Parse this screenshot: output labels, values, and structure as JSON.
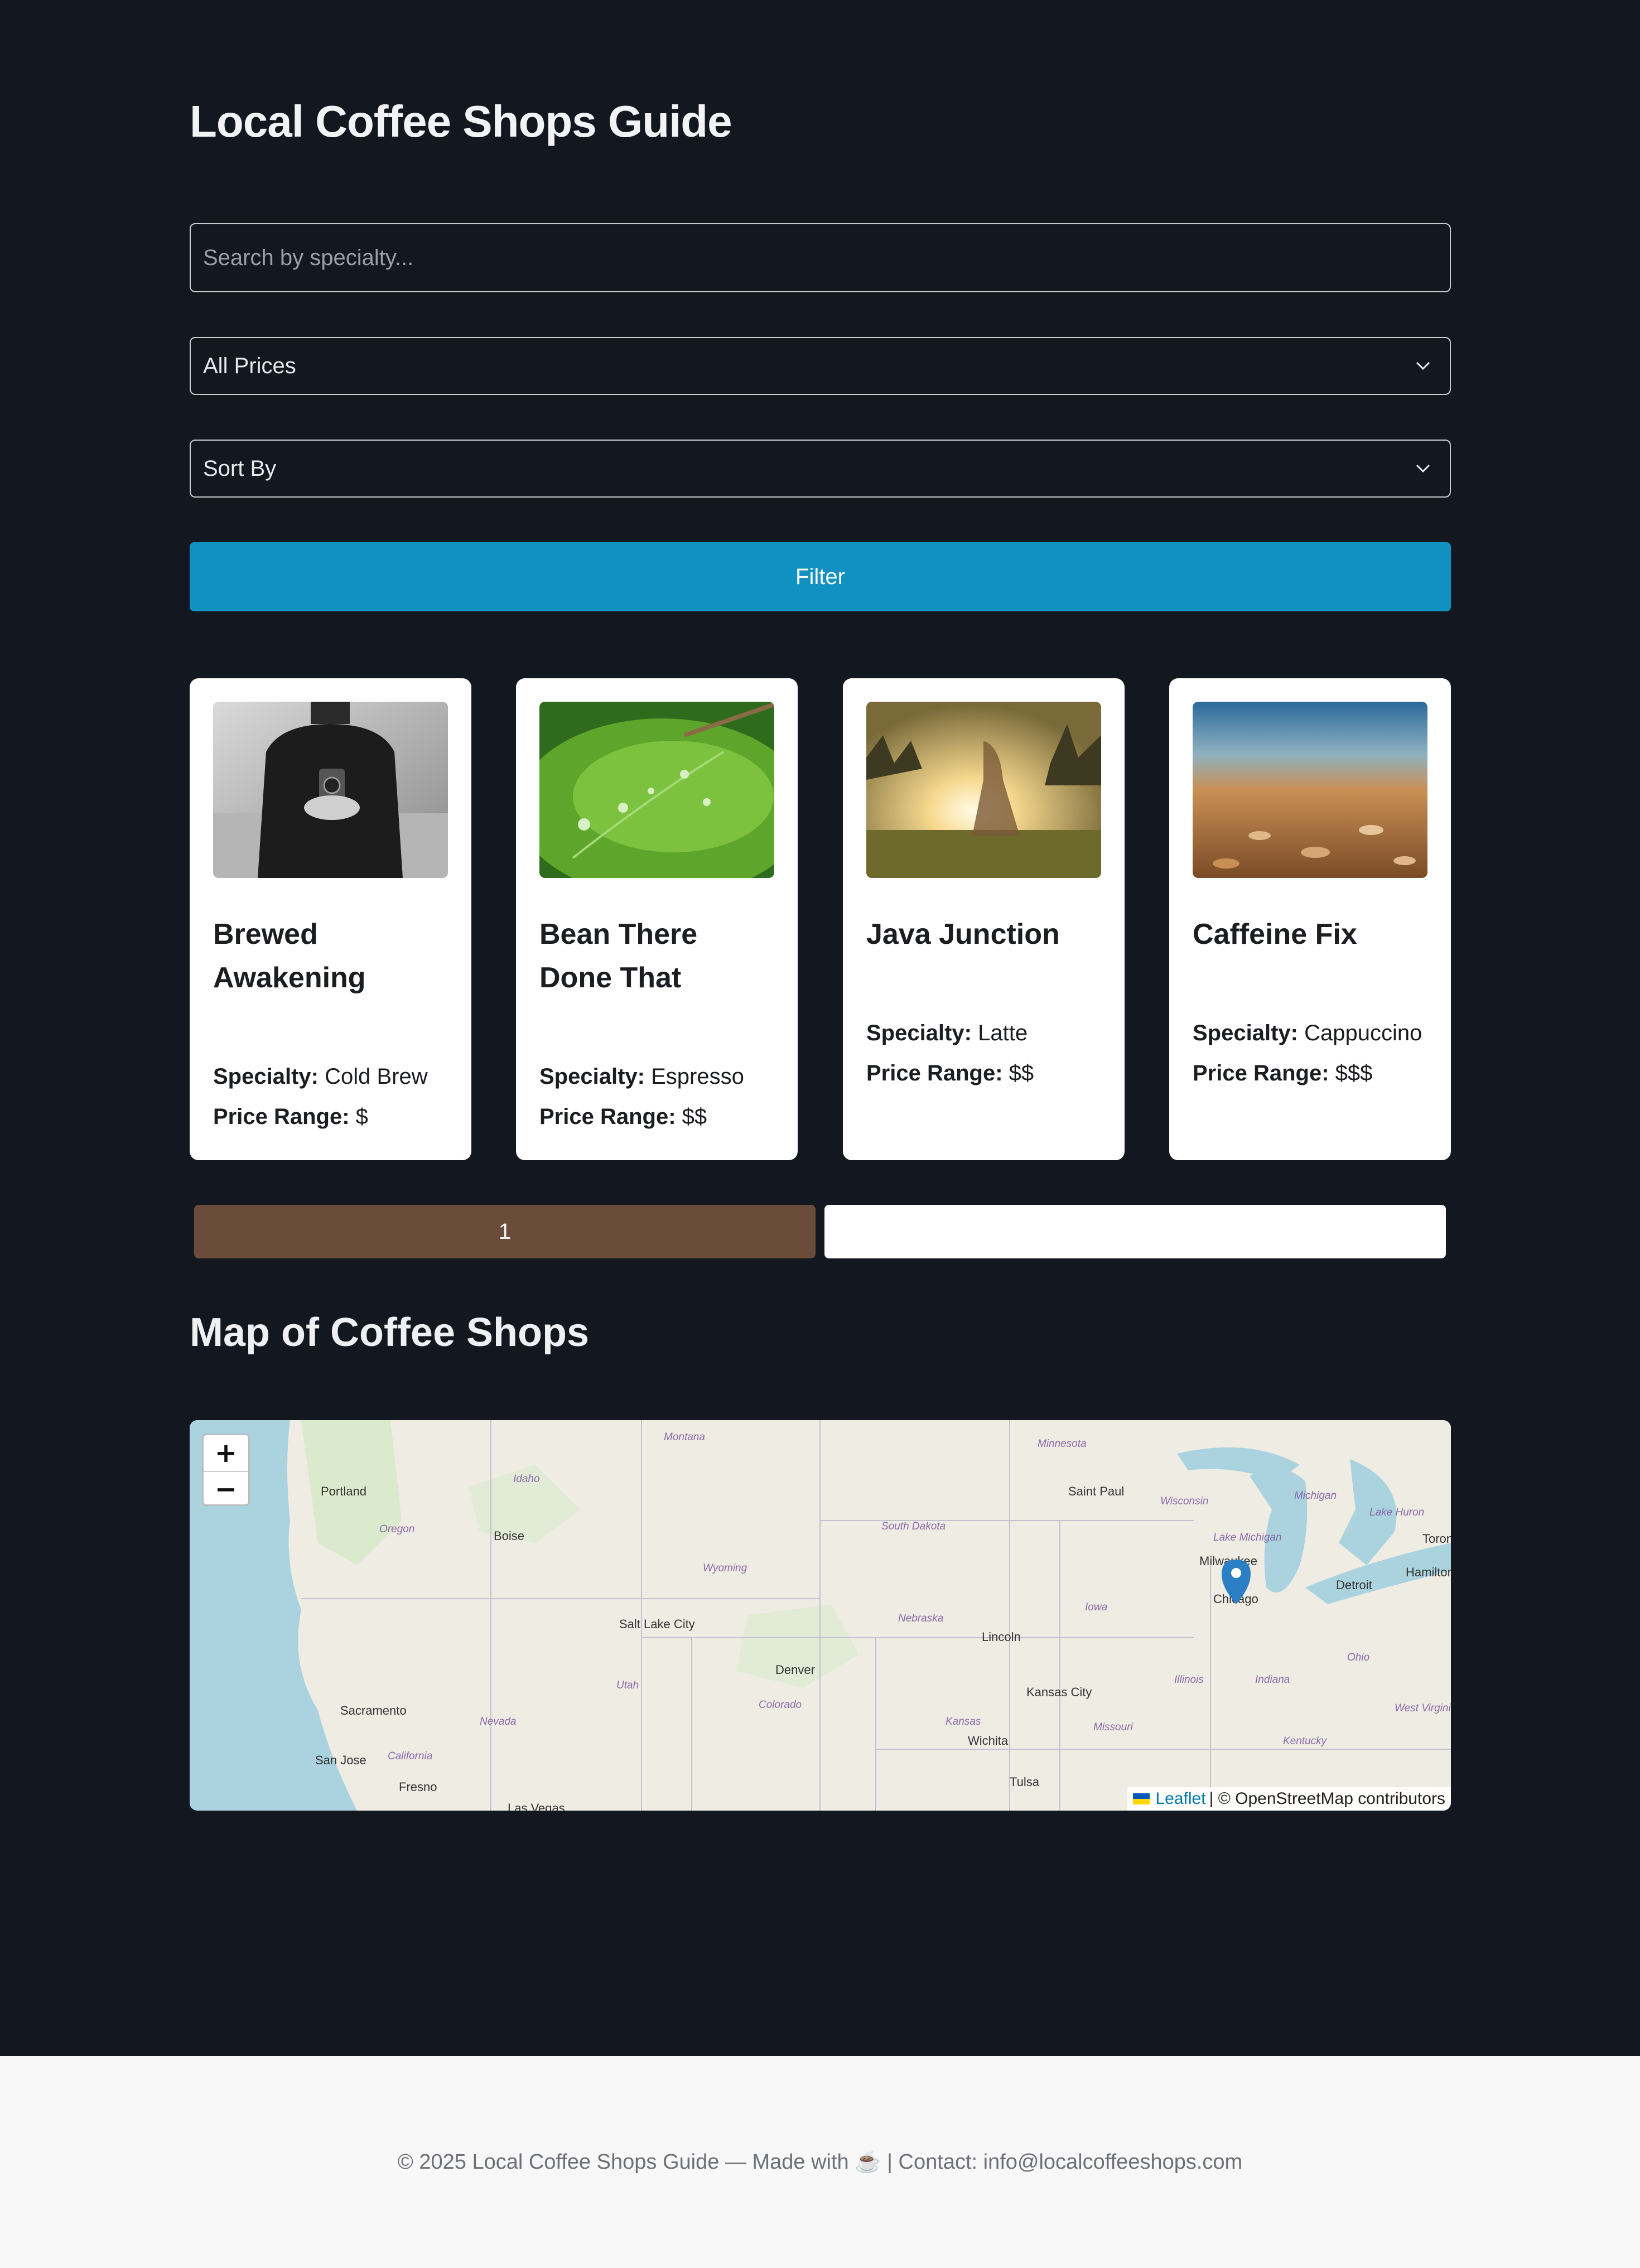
{
  "page": {
    "title": "Local Coffee Shops Guide"
  },
  "filters": {
    "search_placeholder": "Search by specialty...",
    "price_selected": "All Prices",
    "sort_selected": "Sort By",
    "filter_label": "Filter"
  },
  "shops": [
    {
      "name": "Brewed Awakening",
      "specialty_label": "Specialty:",
      "specialty": "Cold Brew",
      "price_label": "Price Range:",
      "price": "$"
    },
    {
      "name": "Bean There Done That",
      "specialty_label": "Specialty:",
      "specialty": "Espresso",
      "price_label": "Price Range:",
      "price": "$$"
    },
    {
      "name": "Java Junction",
      "specialty_label": "Specialty:",
      "specialty": "Latte",
      "price_label": "Price Range:",
      "price": "$$"
    },
    {
      "name": "Caffeine Fix",
      "specialty_label": "Specialty:",
      "specialty": "Cappuccino",
      "price_label": "Price Range:",
      "price": "$$$"
    }
  ],
  "pagination": {
    "page1": "1",
    "page2": ""
  },
  "map": {
    "heading": "Map of Coffee Shops",
    "zoom_in": "+",
    "zoom_out": "−",
    "attribution_link": "Leaflet",
    "attribution_text": "| © OpenStreetMap contributors",
    "cities": [
      "Portland",
      "Boise",
      "Saint Paul",
      "Milwaukee",
      "Detroit",
      "Toronto",
      "Hamilton",
      "Salt Lake City",
      "Lincoln",
      "Denver",
      "Kansas City",
      "Wichita",
      "Tulsa",
      "Sacramento",
      "San Jose",
      "Fresno",
      "Las Vegas",
      "Chicago"
    ],
    "states": [
      "Montana",
      "Minnesota",
      "Idaho",
      "Oregon",
      "South Dakota",
      "Wyoming",
      "Wisconsin",
      "Michigan",
      "Lake Michigan",
      "Lake Huron",
      "Iowa",
      "Nebraska",
      "Illinois",
      "Indiana",
      "Ohio",
      "Utah",
      "Colorado",
      "Nevada",
      "Kansas",
      "Missouri",
      "California",
      "Kentucky",
      "West Virginia"
    ]
  },
  "footer": {
    "text": "© 2025 Local Coffee Shops Guide — Made with ☕ | Contact: info@localcoffeeshops.com"
  },
  "colors": {
    "background": "#131820",
    "accent": "#1191c1",
    "pager_active": "#6b4c3b",
    "marker": "#2b7fc4"
  }
}
